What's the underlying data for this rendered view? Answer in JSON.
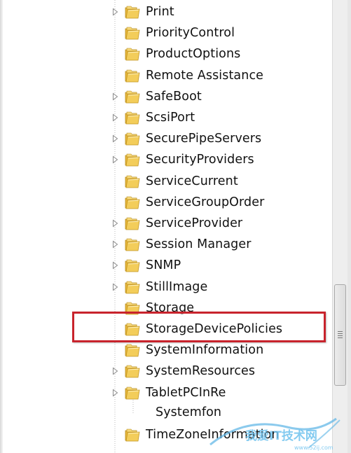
{
  "tree": {
    "nodes": [
      {
        "label": "Print",
        "expander": true
      },
      {
        "label": "PriorityControl",
        "expander": false
      },
      {
        "label": "ProductOptions",
        "expander": false
      },
      {
        "label": "Remote Assistance",
        "expander": false
      },
      {
        "label": "SafeBoot",
        "expander": true
      },
      {
        "label": "ScsiPort",
        "expander": true
      },
      {
        "label": "SecurePipeServers",
        "expander": true
      },
      {
        "label": "SecurityProviders",
        "expander": true
      },
      {
        "label": "ServiceCurrent",
        "expander": false
      },
      {
        "label": "ServiceGroupOrder",
        "expander": false
      },
      {
        "label": "ServiceProvider",
        "expander": true
      },
      {
        "label": "Session Manager",
        "expander": true
      },
      {
        "label": "SNMP",
        "expander": true
      },
      {
        "label": "StillImage",
        "expander": true
      },
      {
        "label": "Storage",
        "expander": false
      },
      {
        "label": "StorageDevicePolicies",
        "expander": false
      },
      {
        "label": "SystemInformation",
        "expander": false
      },
      {
        "label": "SystemResources",
        "expander": true
      },
      {
        "label": "TabletPCInRe",
        "expander": true
      },
      {
        "label": "TimeZoneInformation",
        "expander": false
      }
    ],
    "child_label": "Systemfon",
    "highlighted": "StorageDevicePolicies"
  },
  "watermark": {
    "text": "我爱IT技术网",
    "url": "www.52ij.com"
  },
  "colors": {
    "highlight_border": "#c8232c",
    "folder_yellow": "#f3cd5a"
  }
}
